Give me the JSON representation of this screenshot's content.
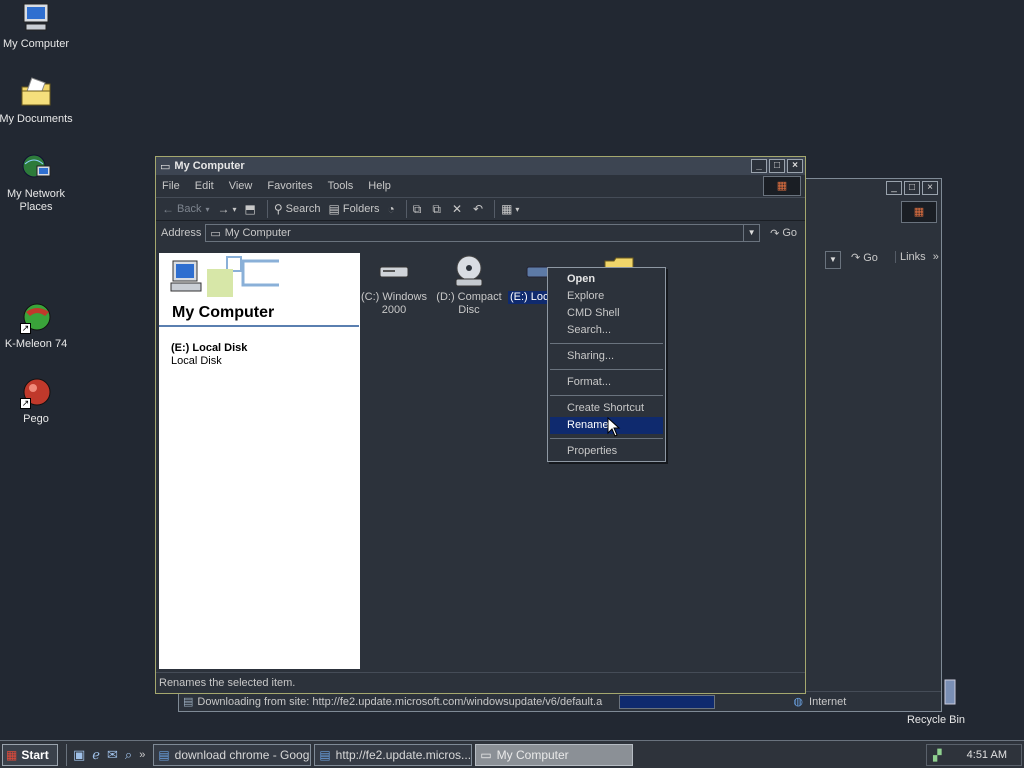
{
  "desktop": {
    "icons": [
      {
        "label": "My Computer"
      },
      {
        "label": "My Documents"
      },
      {
        "label": "My Network Places"
      },
      {
        "label": "K-Meleon 74"
      },
      {
        "label": "Pego"
      },
      {
        "label": "Recycle Bin"
      }
    ]
  },
  "back_window": {
    "go_label": "Go",
    "links_label": "Links",
    "status_text": "Downloading from site: http://fe2.update.microsoft.com/windowsupdate/v6/default.a",
    "zone_label": "Internet"
  },
  "main_window": {
    "title": "My Computer",
    "menu": [
      "File",
      "Edit",
      "View",
      "Favorites",
      "Tools",
      "Help"
    ],
    "toolbar": {
      "back": "Back",
      "search": "Search",
      "folders": "Folders"
    },
    "address": {
      "label": "Address",
      "value": "My Computer",
      "go": "Go"
    },
    "left_pane": {
      "title": "My Computer",
      "selected_name": "(E:) Local Disk",
      "selected_type": "Local Disk"
    },
    "drives": [
      {
        "line1": "(C:) Windows",
        "line2": "2000"
      },
      {
        "line1": "(D:) Compact",
        "line2": "Disc"
      },
      {
        "line1": "(E:) Loc",
        "line2": ""
      }
    ],
    "status": "Renames the selected item."
  },
  "context_menu": {
    "items": [
      {
        "label": "Open"
      },
      {
        "label": "Explore"
      },
      {
        "label": "CMD Shell"
      },
      {
        "label": "Search..."
      },
      {
        "label": "Sharing..."
      },
      {
        "label": "Format..."
      },
      {
        "label": "Create Shortcut"
      },
      {
        "label": "Rename"
      },
      {
        "label": "Properties"
      }
    ],
    "highlighted": "Rename"
  },
  "taskbar": {
    "start": "Start",
    "tasks": [
      {
        "label": "download chrome - Googl..."
      },
      {
        "label": "http://fe2.update.micros..."
      },
      {
        "label": "My Computer"
      }
    ],
    "clock": "4:51 AM"
  },
  "colors": {
    "desktop": "#222832",
    "window": "#2c323b",
    "highlight": "#0f2a6e"
  }
}
